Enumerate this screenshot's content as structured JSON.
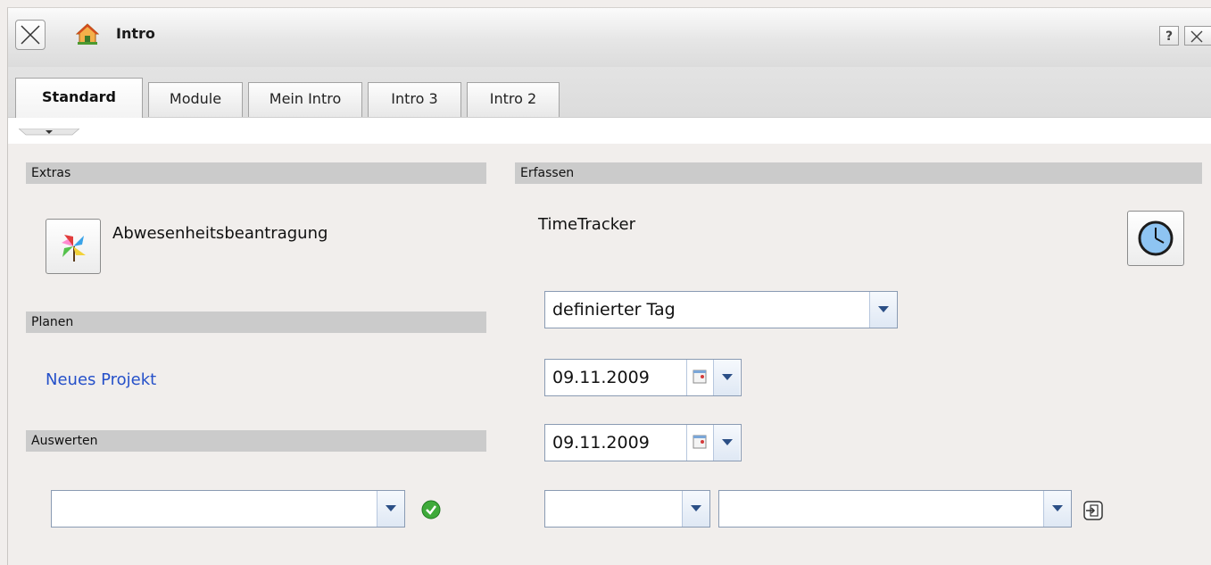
{
  "window": {
    "title": "Intro"
  },
  "title_buttons": {
    "help_label": "?"
  },
  "tabs": [
    {
      "label": "Standard",
      "active": true
    },
    {
      "label": "Module",
      "active": false
    },
    {
      "label": "Mein Intro",
      "active": false
    },
    {
      "label": "Intro 3",
      "active": false
    },
    {
      "label": "Intro 2",
      "active": false
    }
  ],
  "sections": {
    "extras": {
      "header": "Extras",
      "item_label": "Abwesenheitsbeantragung"
    },
    "planen": {
      "header": "Planen",
      "link_label": "Neues Projekt"
    },
    "auswerten": {
      "header": "Auswerten",
      "select_value": ""
    },
    "erfassen": {
      "header": "Erfassen",
      "tracker_label": "TimeTracker",
      "mode_select": "definierter Tag",
      "date_from": "09.11.2009",
      "date_to": "09.11.2009",
      "select_a": "",
      "select_b": ""
    }
  },
  "colors": {
    "link": "#2550c9",
    "section_header_bg": "#cbcbcb",
    "page_bg": "#f1eeec"
  }
}
